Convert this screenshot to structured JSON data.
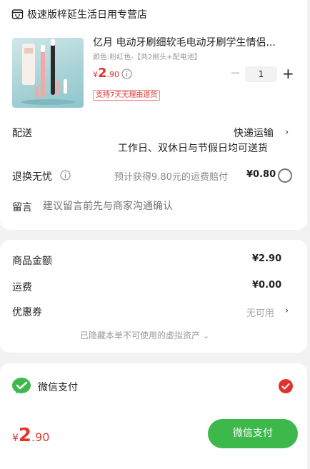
{
  "store": {
    "name": "极速版梓延生活日用专营店",
    "icon": "store-icon"
  },
  "product": {
    "title": "亿月 电动牙刷细软毛电动牙刷学生情侣...",
    "spec": "颜色:粉红色-【共2刷头+配电池】",
    "price": {
      "symbol": "¥",
      "integer": "2",
      "decimal": ".90"
    },
    "quantity": "1",
    "tag": "支持7天无理由退货",
    "info_icon": "info-icon"
  },
  "delivery": {
    "label": "配送",
    "method": "快递运输",
    "note": "工作日、双休日与节假日均可送货"
  },
  "return": {
    "label": "退换无忧",
    "text": "预计获得9.80元的运费赔付",
    "price": "¥0.80"
  },
  "message": {
    "label": "留言",
    "placeholder": "建议留言前先与商家沟通确认"
  },
  "summary": {
    "goods_label": "商品金额",
    "goods_value": "¥2.90",
    "shipping_label": "运费",
    "shipping_value": "¥0.00",
    "coupon_label": "优惠券",
    "coupon_value": "无可用",
    "hidden_note": "已隐藏本单不可使用的虚拟资产"
  },
  "payment": {
    "method_label": "微信支付",
    "method_icon": "wechat-pay-icon"
  },
  "footer": {
    "total": {
      "symbol": "¥",
      "integer": "2",
      "decimal": ".90"
    },
    "pay_button": "微信支付"
  },
  "colors": {
    "accent_red": "#e5322d",
    "wechat_green": "#3db94c",
    "background": "#f2f2f2"
  }
}
